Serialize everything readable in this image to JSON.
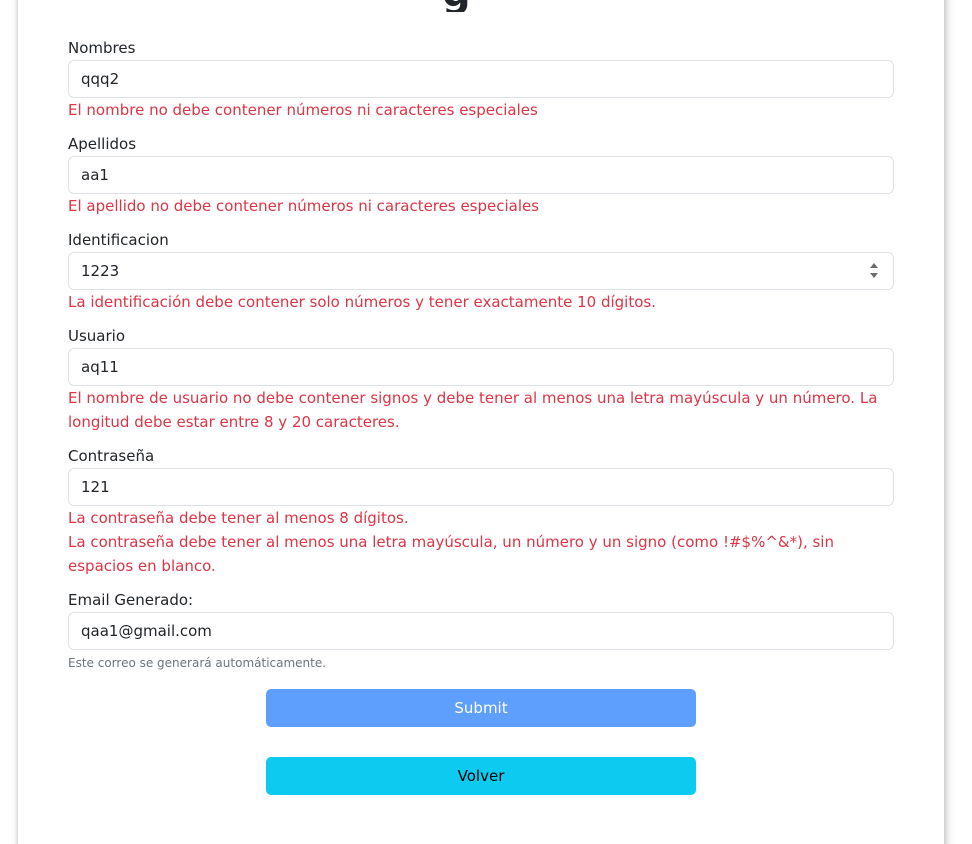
{
  "form": {
    "nombres": {
      "label": "Nombres",
      "value": "qqq2",
      "error": "El nombre no debe contener números ni caracteres especiales"
    },
    "apellidos": {
      "label": "Apellidos",
      "value": "aa1",
      "error": "El apellido no debe contener números ni caracteres especiales"
    },
    "identificacion": {
      "label": "Identificacion",
      "value": "1223",
      "error": "La identificación debe contener solo números y tener exactamente 10 dígitos."
    },
    "usuario": {
      "label": "Usuario",
      "value": "aq11",
      "error": "El nombre de usuario no debe contener signos y debe tener al menos una letra mayúscula y un número. La longitud debe estar entre 8 y 20 caracteres."
    },
    "contrasena": {
      "label": "Contraseña",
      "value": "121",
      "error_length": "La contraseña debe tener al menos 8 dígitos.",
      "error_complexity": "La contraseña debe tener al menos una letra mayúscula, un número y un signo (como !#$%^&*), sin espacios en blanco."
    },
    "email": {
      "label": "Email Generado:",
      "value": "qaa1@gmail.com",
      "help": "Este correo se generará automáticamente."
    }
  },
  "buttons": {
    "submit": "Submit",
    "back": "Volver"
  },
  "colors": {
    "error": "#dc3545",
    "submit_bg": "#5e9efc",
    "back_bg": "#0dcaf0",
    "help": "#6c757d"
  }
}
